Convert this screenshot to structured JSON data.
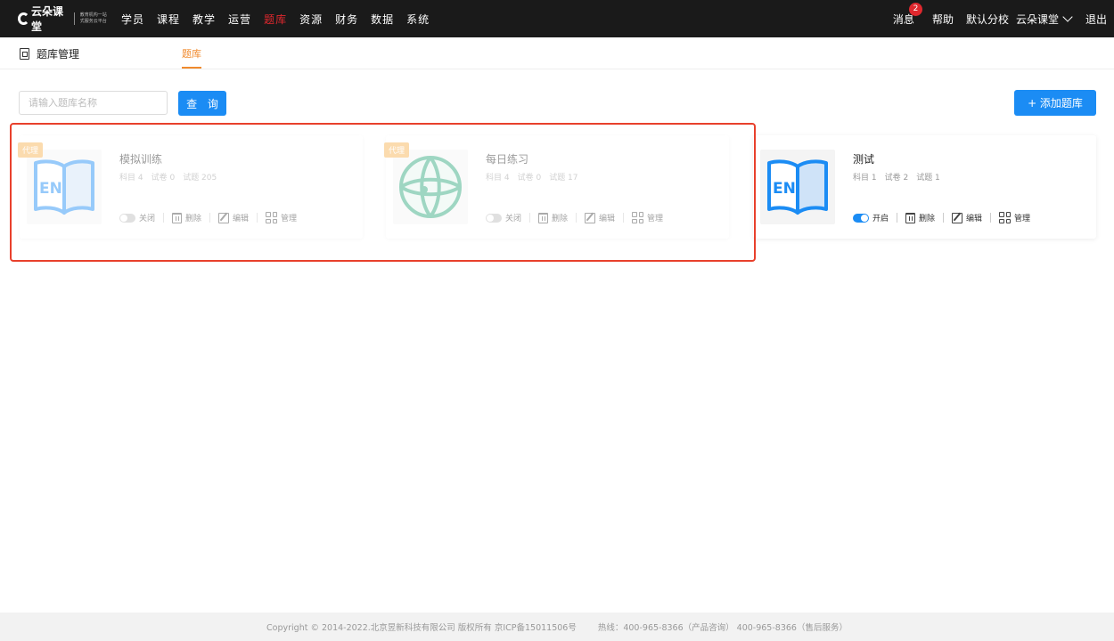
{
  "logo": {
    "name": "云朵课堂",
    "tagline": "教育机构一站式服务云平台"
  },
  "nav": {
    "items": [
      "学员",
      "课程",
      "教学",
      "运营",
      "题库",
      "资源",
      "财务",
      "数据",
      "系统"
    ],
    "active_index": 4
  },
  "topRight": {
    "messages": "消息",
    "messages_badge": "2",
    "help": "帮助",
    "branch": "默认分校",
    "org": "云朵课堂",
    "logout": "退出"
  },
  "subheader": {
    "title": "题库管理",
    "tab": "题库"
  },
  "search": {
    "placeholder": "请输入题库名称",
    "query_label": "查 询",
    "add_label": "+ 添加题库"
  },
  "cards": [
    {
      "tag": "代理",
      "name": "模拟训练",
      "subjects": "科目 4",
      "papers": "试卷 0",
      "questions": "试题 205",
      "toggle_label": "关闭",
      "toggle_on": false,
      "delete": "删除",
      "edit": "编辑",
      "manage": "管理",
      "thumb": "EN",
      "dimmed": true
    },
    {
      "tag": "代理",
      "name": "每日练习",
      "subjects": "科目 4",
      "papers": "试卷 0",
      "questions": "试题 17",
      "toggle_label": "关闭",
      "toggle_on": false,
      "delete": "删除",
      "edit": "编辑",
      "manage": "管理",
      "thumb": "globe",
      "dimmed": true
    },
    {
      "tag": "",
      "name": "测试",
      "subjects": "科目 1",
      "papers": "试卷 2",
      "questions": "试题 1",
      "toggle_label": "开启",
      "toggle_on": true,
      "delete": "删除",
      "edit": "编辑",
      "manage": "管理",
      "thumb": "EN",
      "dimmed": false
    }
  ],
  "footer": {
    "copyright": "Copyright © 2014-2022.北京昱新科技有限公司 版权所有 京ICP备15011506号",
    "hotline": "热线：400-965-8366（产品咨询） 400-965-8366（售后服务）"
  },
  "colors": {
    "accent": "#1b8cf4",
    "active_nav": "#e0282e",
    "tab": "#f08a2d",
    "tag": "#f7b04e",
    "highlight": "#e8402c"
  }
}
